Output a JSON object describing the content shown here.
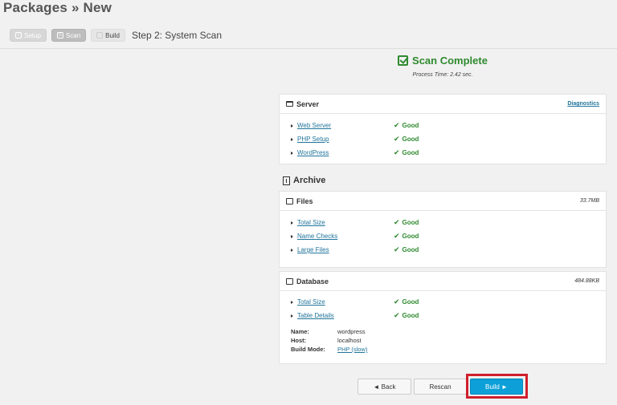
{
  "page": {
    "title": "Packages » New"
  },
  "steps": {
    "items": [
      {
        "label": "Setup",
        "state": "done",
        "icon": "setup-icon"
      },
      {
        "label": "Scan",
        "state": "active",
        "icon": "scan-icon"
      },
      {
        "label": "Build",
        "state": "next",
        "icon": "build-icon"
      }
    ],
    "current_title": "Step 2: System Scan"
  },
  "scan": {
    "title": "Scan Complete",
    "process_time": "Process Time: 2.42 sec."
  },
  "server": {
    "title": "Server",
    "diagnostics_link": "Diagnostics",
    "checks": [
      {
        "label": "Web Server",
        "status": "Good"
      },
      {
        "label": "PHP Setup",
        "status": "Good"
      },
      {
        "label": "WordPress",
        "status": "Good"
      }
    ]
  },
  "archive": {
    "title": "Archive",
    "files": {
      "title": "Files",
      "size": "33.7MB",
      "checks": [
        {
          "label": "Total Size",
          "status": "Good"
        },
        {
          "label": "Name Checks",
          "status": "Good"
        },
        {
          "label": "Large Files",
          "status": "Good"
        }
      ]
    },
    "database": {
      "title": "Database",
      "size": "484.88KB",
      "checks": [
        {
          "label": "Total Size",
          "status": "Good"
        },
        {
          "label": "Table Details",
          "status": "Good"
        }
      ],
      "info": {
        "name_label": "Name:",
        "name_value": "wordpress",
        "host_label": "Host:",
        "host_value": "localhost",
        "mode_label": "Build Mode:",
        "mode_value": "PHP (slow)"
      }
    }
  },
  "buttons": {
    "back": "◄ Back",
    "rescan": "Rescan",
    "build": "Build ►"
  },
  "colors": {
    "good": "#2f8a2f",
    "link": "#21759b",
    "primary": "#0da0d8",
    "highlight": "#d01f2c"
  }
}
